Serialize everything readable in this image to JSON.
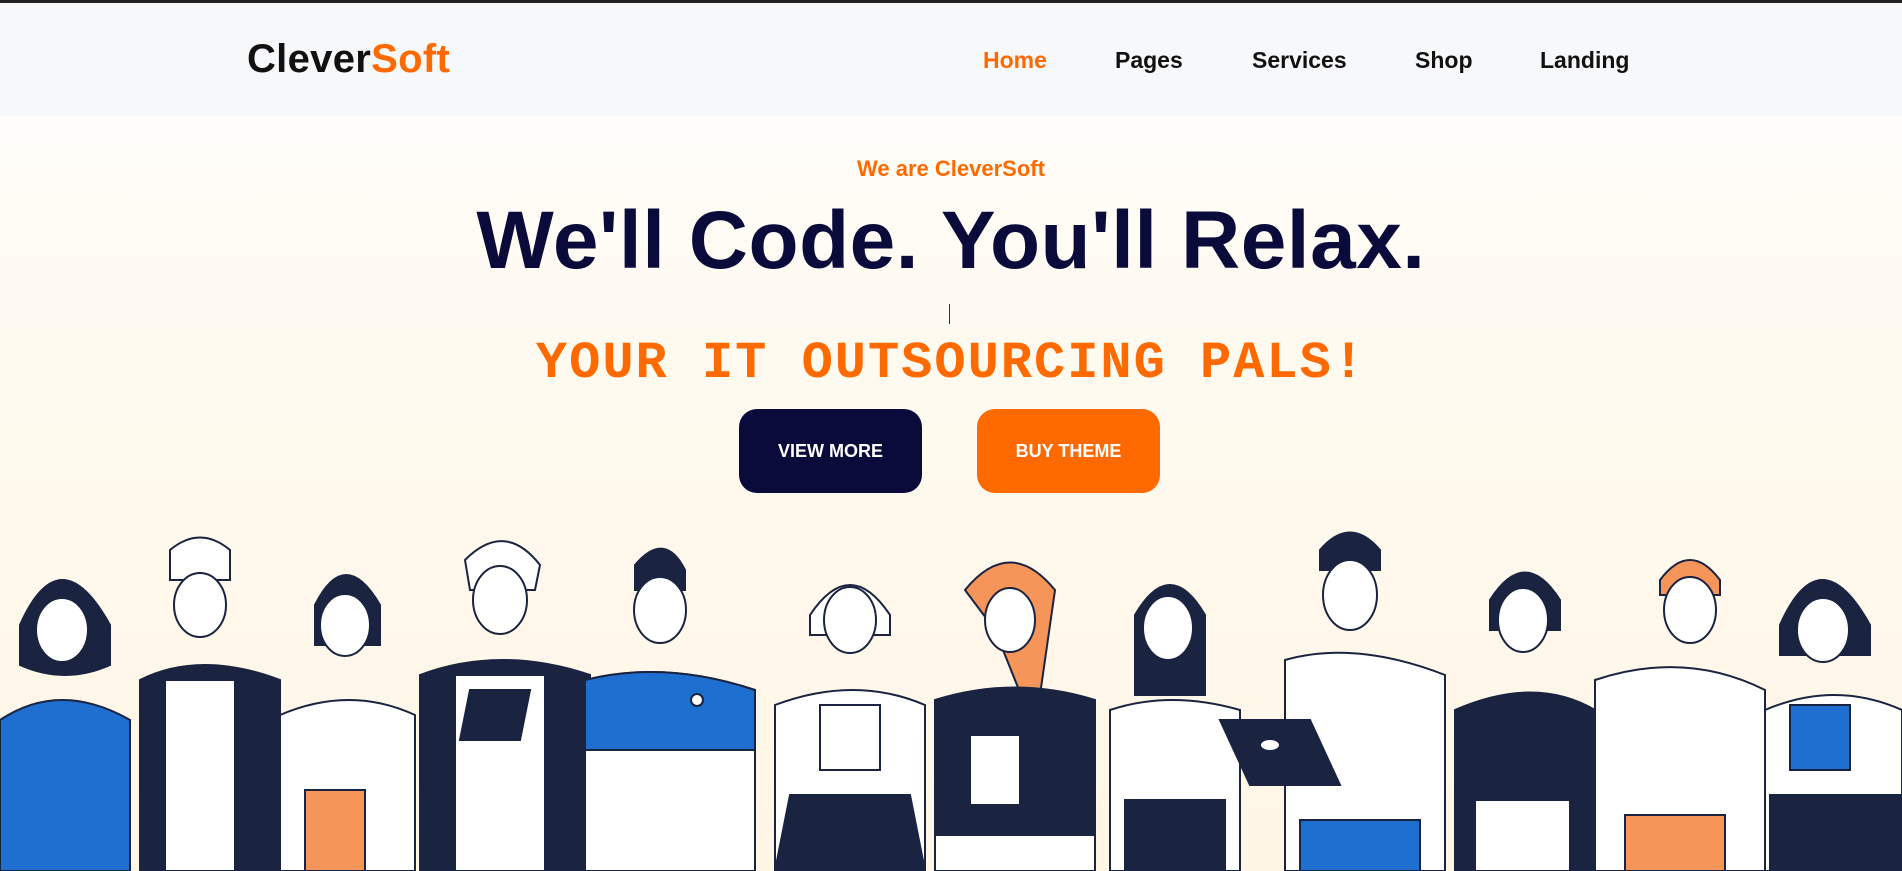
{
  "brand": {
    "part1": "Clever",
    "part2": "Soft"
  },
  "nav": {
    "items": [
      {
        "label": "Home",
        "active": true
      },
      {
        "label": "Pages",
        "active": false
      },
      {
        "label": "Services",
        "active": false
      },
      {
        "label": "Shop",
        "active": false
      },
      {
        "label": "Landing",
        "active": false
      }
    ]
  },
  "hero": {
    "eyebrow": "We are CleverSoft",
    "title": "We'll Code. You'll Relax.",
    "tagline": "YOUR IT OUTSOURCING PALS!",
    "buttons": {
      "view_more": "VIEW MORE",
      "buy_theme": "BUY THEME"
    }
  },
  "colors": {
    "accent": "#ff6a00",
    "navy": "#0b0b3b",
    "blue": "#1f6fd1"
  },
  "illustration": {
    "icon_names": [
      "person-1",
      "person-2",
      "person-3",
      "person-4",
      "person-5",
      "person-6",
      "person-7",
      "person-8",
      "person-9",
      "person-10",
      "person-11",
      "person-12",
      "person-13"
    ]
  }
}
